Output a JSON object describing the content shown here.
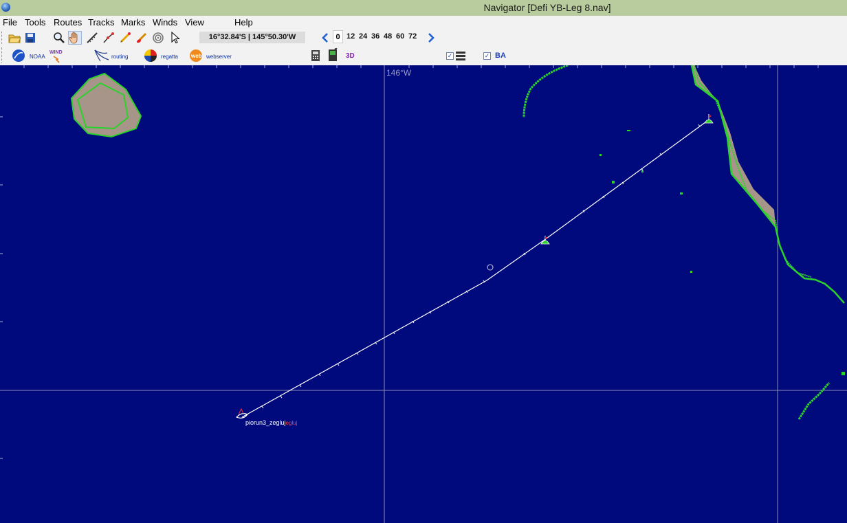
{
  "window": {
    "title": "Navigator [Defi YB-Leg 8.nav]"
  },
  "menu": [
    "File",
    "Tools",
    "Routes",
    "Tracks",
    "Marks",
    "Winds",
    "View",
    "Help"
  ],
  "toolbar": {
    "coordinates": "16°32.84'S | 145°50.30'W",
    "forecast_hours": [
      "0",
      "12",
      "24",
      "36",
      "48",
      "60",
      "72"
    ],
    "selected_hour": "0"
  },
  "toolbar2": {
    "noaa_label": "NOAA",
    "wind_label": "WIND",
    "routing_label": "routing",
    "regatta_label": "regatta",
    "web_label": "web",
    "webserver_label": "webserver",
    "three_d_label": "3D",
    "ba_label": "BA",
    "list_checked": true,
    "ba_checked": true
  },
  "chart": {
    "meridian_label": "146°W",
    "boat_label_primary": "piorun3_zegluj",
    "boat_label_secondary": "egluj",
    "colors": {
      "sea": "#000a7c",
      "land": "#a8958a",
      "coast": "#2bd22b",
      "track": "#ffffff",
      "grid": "#8c8cb4"
    }
  }
}
